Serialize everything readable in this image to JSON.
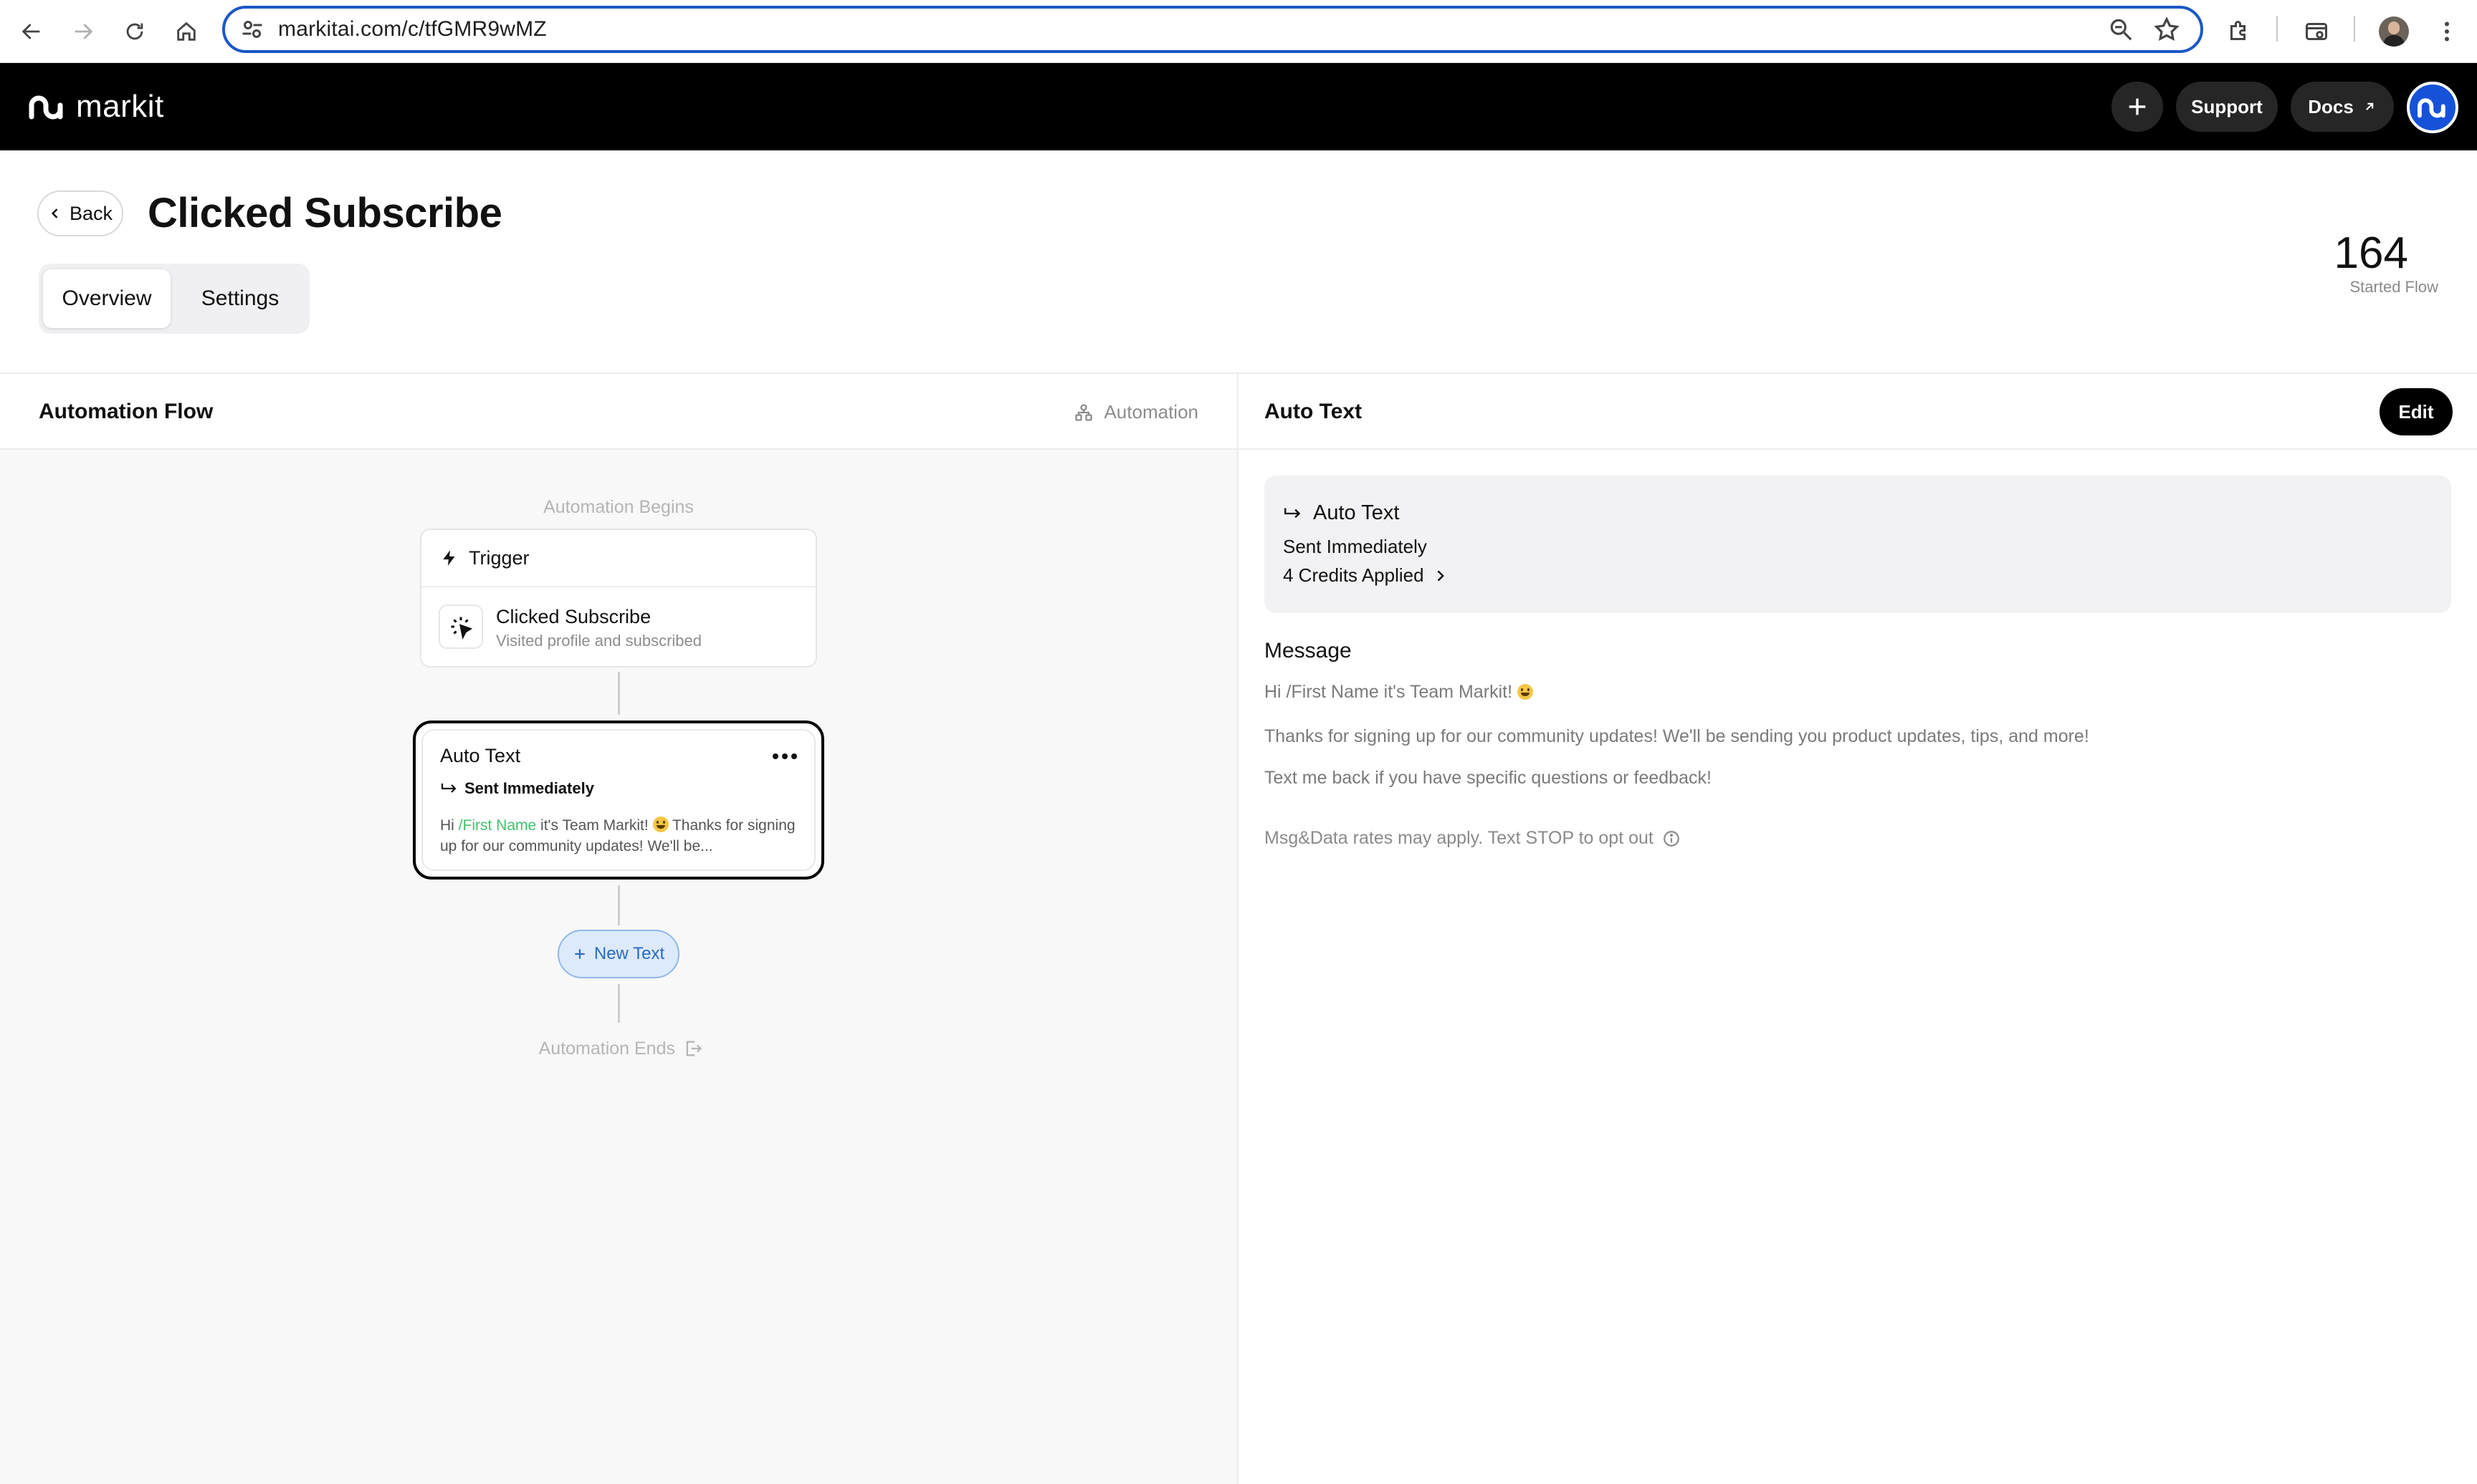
{
  "browser": {
    "url": "markitai.com/c/tfGMR9wMZ"
  },
  "header": {
    "brand": "markit",
    "support_label": "Support",
    "docs_label": "Docs"
  },
  "page": {
    "back_label": "Back",
    "title": "Clicked Subscribe",
    "tabs": [
      {
        "label": "Overview",
        "active": true
      },
      {
        "label": "Settings",
        "active": false
      }
    ],
    "stat": {
      "value": "164",
      "label": "Started Flow"
    }
  },
  "flow": {
    "panel_title": "Automation Flow",
    "panel_tag": "Automation",
    "begins_label": "Automation Begins",
    "trigger": {
      "header": "Trigger",
      "name": "Clicked Subscribe",
      "description": "Visited profile and subscribed"
    },
    "step": {
      "title": "Auto Text",
      "timing": "Sent Immediately",
      "preview_prefix": "Hi ",
      "preview_variable": "/First Name",
      "preview_mid": " it's Team Markit! ",
      "preview_rest": " Thanks for signing up for our community updates! We'll be..."
    },
    "new_text_label": "New Text",
    "ends_label": "Automation Ends"
  },
  "detail": {
    "title": "Auto Text",
    "edit_label": "Edit",
    "summary": {
      "name": "Auto Text",
      "timing": "Sent Immediately",
      "credits": "4 Credits Applied"
    },
    "message_heading": "Message",
    "message_lines": [
      "Hi /First Name it's Team Markit!",
      "Thanks for signing up for our community updates! We'll be sending you product updates, tips, and more!",
      "Text me back if you have specific questions or feedback!"
    ],
    "disclaimer": "Msg&Data rates may apply. Text STOP to opt out"
  },
  "colors": {
    "accent_blue": "#1652d8",
    "variable_green": "#3fc16c",
    "header_black": "#000000"
  },
  "icons": [
    "back-arrow-icon",
    "forward-arrow-icon",
    "reload-icon",
    "home-icon",
    "site-settings-icon",
    "zoom-icon",
    "star-icon",
    "extensions-icon",
    "tab-search-icon",
    "kebab-menu-icon",
    "plus-icon",
    "external-link-icon",
    "chevron-left-icon",
    "automation-icon",
    "lightning-icon",
    "click-cursor-icon",
    "ellipsis-icon",
    "reply-arrow-icon",
    "exit-icon",
    "chevron-right-icon",
    "info-icon",
    "smile-emoji-icon"
  ]
}
